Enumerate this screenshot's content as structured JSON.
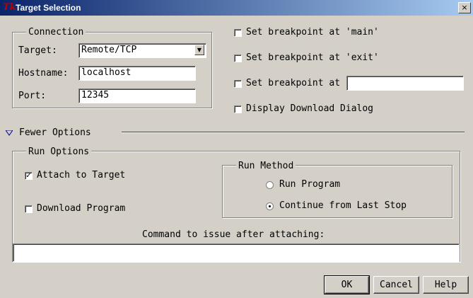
{
  "window": {
    "title": "Target Selection",
    "close_glyph": "×",
    "logo_text": "Tk"
  },
  "connection": {
    "legend": "Connection",
    "target_label": "Target:",
    "target_value": "Remote/TCP",
    "hostname_label": "Hostname:",
    "hostname_value": "localhost",
    "port_label": "Port:",
    "port_value": "12345"
  },
  "breakpoints": {
    "main_label": "Set breakpoint at 'main'",
    "main_checked": false,
    "exit_label": "Set breakpoint at 'exit'",
    "exit_checked": false,
    "at_label": "Set breakpoint at",
    "at_checked": false,
    "at_value": "",
    "download_dialog_label": "Display Download Dialog",
    "download_dialog_checked": false
  },
  "options_toggle": {
    "label": "Fewer Options",
    "icon": "triangle-down-icon"
  },
  "run_options": {
    "legend": "Run Options",
    "attach_label": "Attach to Target",
    "attach_checked": true,
    "download_label": "Download Program",
    "download_checked": false,
    "run_method": {
      "legend": "Run Method",
      "run_program_label": "Run Program",
      "continue_label": "Continue from Last Stop",
      "selected": "continue"
    },
    "command_label": "Command to issue after attaching:",
    "command_value": ""
  },
  "buttons": {
    "ok": "OK",
    "cancel": "Cancel",
    "help": "Help"
  }
}
